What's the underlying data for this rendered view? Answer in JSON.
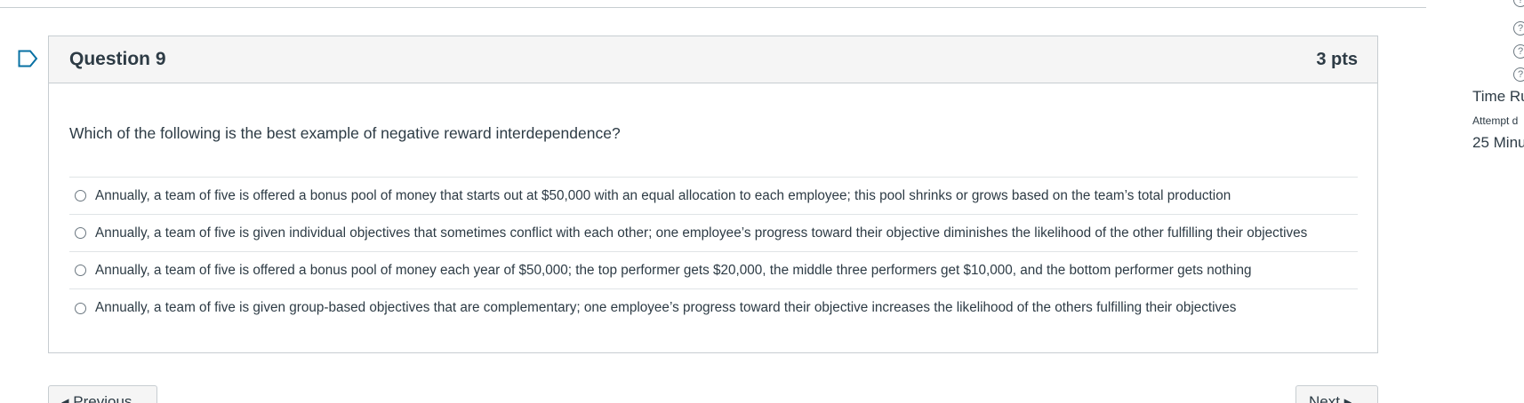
{
  "question": {
    "title": "Question 9",
    "points": "3 pts",
    "text": "Which of the following is the best example of negative reward interdependence?",
    "answers": [
      "Annually, a team of five is offered a bonus pool of money that starts out at $50,000 with an equal allocation to each employee; this pool shrinks or grows based on the team’s total production",
      "Annually, a team of five is given individual objectives that sometimes conflict with each other; one employee’s progress toward their objective diminishes the likelihood of the other fulfilling their objectives",
      "Annually, a team of five is offered a bonus pool of money each year of $50,000; the top performer gets $20,000, the middle three performers get $10,000, and the bottom performer gets nothing",
      "Annually, a team of five is given group-based objectives that are complementary; one employee’s progress toward their objective increases the likelihood of the others fulfilling their objectives"
    ]
  },
  "navigation": {
    "previous_label": "◂ Previous",
    "next_label": "Next ▸"
  },
  "sidebar": {
    "time_label": "Time Ru",
    "attempt_label": "Attempt d",
    "duration": "25 Minu"
  },
  "colors": {
    "header_bg": "#f5f5f5",
    "border": "#c7cdd1",
    "text": "#2d3b45"
  },
  "icons": {
    "flag": "bookmark-flag-icon",
    "help": "question-circle-icon",
    "radio": "radio-button-icon"
  }
}
